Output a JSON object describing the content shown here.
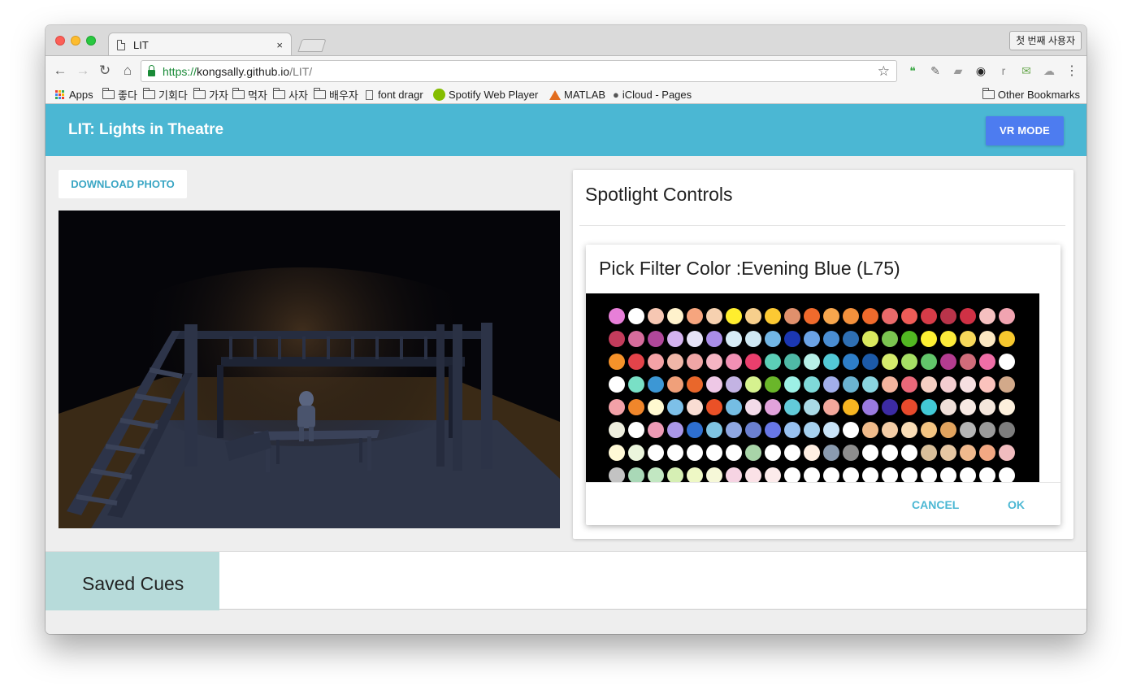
{
  "browser": {
    "tab_title": "LIT",
    "tab_close": "×",
    "profile_label": "첫 번째 사용자",
    "url_scheme": "https://",
    "url_host": "kongsally.github.io",
    "url_path": "/LIT/",
    "nav_back": "←",
    "nav_forward": "→",
    "nav_reload": "↻",
    "nav_home": "⌂",
    "star": "☆",
    "menu": "⋮",
    "extensions": [
      {
        "name": "hangouts-icon",
        "glyph": "❝",
        "color": "#3aa745"
      },
      {
        "name": "eyedropper-icon",
        "glyph": "✎",
        "color": "#666666"
      },
      {
        "name": "pin-icon",
        "glyph": "▰",
        "color": "#9a9a9a"
      },
      {
        "name": "panda-icon",
        "glyph": "◉",
        "color": "#222222"
      },
      {
        "name": "r-icon",
        "glyph": "r",
        "color": "#888888"
      },
      {
        "name": "inbox-icon",
        "glyph": "✉",
        "color": "#6aa84f"
      },
      {
        "name": "cloud-icon",
        "glyph": "☁",
        "color": "#9a9a9a"
      }
    ],
    "bookmarks": [
      {
        "label": "Apps",
        "icon": "apps"
      },
      {
        "label": "좋다",
        "icon": "folder"
      },
      {
        "label": "기회다",
        "icon": "folder"
      },
      {
        "label": "가자",
        "icon": "folder"
      },
      {
        "label": "먹자",
        "icon": "folder"
      },
      {
        "label": "사자",
        "icon": "folder"
      },
      {
        "label": "배우자",
        "icon": "folder"
      },
      {
        "label": "font dragr",
        "icon": "page"
      },
      {
        "label": "Spotify Web Player",
        "icon": "spotify"
      },
      {
        "label": "MATLAB",
        "icon": "matlab"
      },
      {
        "label": "iCloud - Pages",
        "icon": "apple"
      }
    ],
    "other_bookmarks": "Other Bookmarks"
  },
  "app": {
    "title": "LIT: Lights in Theatre",
    "vr_button": "VR MODE",
    "download_button": "DOWNLOAD PHOTO",
    "spotlight_title": "Spotlight Controls",
    "dialog": {
      "title": "Pick Filter Color :Evening Blue (L75)",
      "cancel": "CANCEL",
      "ok": "OK"
    },
    "saved_cues": "Saved Cues"
  },
  "swatch_colors": [
    [
      "#e77fd8",
      "#ffffff",
      "#f6c7b3",
      "#fff2cc",
      "#f6a57e",
      "#f6d1b0",
      "#ffee2e",
      "#f7cf8c",
      "#fcc933",
      "#e0906c",
      "#ef6a2c",
      "#f7a64d",
      "#f3903c",
      "#ef6a2c",
      "#ea6a6a",
      "#ef5c57",
      "#d63c48",
      "#b9344a",
      "#d03145",
      "#f5c0c0",
      "#f1a4b1"
    ],
    [
      "#c33c5c",
      "#d66c9c",
      "#b0479a",
      "#d4b3ef",
      "#e6e3f7",
      "#a98de8",
      "#d7ecf6",
      "#cfe8f3",
      "#72b6e5",
      "#1b37b2",
      "#6ba3e6",
      "#4a8ed3",
      "#2e6fb3",
      "#d9e95e",
      "#7bc550",
      "#52b822",
      "#fdf033",
      "#fdeb3a",
      "#f7d85a",
      "#fbe7c1",
      "#f7c82e"
    ],
    [
      "#f5922a",
      "#e3434a",
      "#f4a2a6",
      "#f0b7a8",
      "#f0a6a6",
      "#f5b5c3",
      "#f190b4",
      "#ea3f6d",
      "#5ccfb7",
      "#4fb9a6",
      "#b7f0e8",
      "#53c9d6",
      "#2e7ec8",
      "#1c5aa8",
      "#d5ec6c",
      "#a6df64",
      "#62c66a",
      "#b43c90",
      "#d06c7a",
      "#ee6ea6",
      "#ffffff"
    ],
    [
      "#ffffff",
      "#79e0c6",
      "#3c97d5",
      "#f0a07a",
      "#e9672b",
      "#eec8e6",
      "#c3b3e3",
      "#d6f28f",
      "#6ab62a",
      "#9df0e6",
      "#7fd9d9",
      "#a2aeea",
      "#6bb3d1",
      "#8ad5e0",
      "#f4b49e",
      "#ea6879",
      "#f6cfc3",
      "#f3cdd0",
      "#f6dfe1",
      "#fbc3bd",
      "#d2a98a"
    ],
    [
      "#f2a1a8",
      "#f0862b",
      "#fff9d0",
      "#7dc0e8",
      "#f9ddd3",
      "#ea5127",
      "#75bde3",
      "#f3dbe9",
      "#e2a2db",
      "#62cbd9",
      "#a9d9e6",
      "#f3a89c",
      "#f7b521",
      "#9a7ae0",
      "#3c2ba4",
      "#e84a2c",
      "#42c9d6",
      "#f0dfd8",
      "#f7e9e3",
      "#f4e6db",
      "#fdf0dc"
    ],
    [
      "#eeeede",
      "#ffffff",
      "#ee9ab5",
      "#aa97e8",
      "#2e6fd0",
      "#7fc4e2",
      "#8fa7e2",
      "#6b80d1",
      "#6877e6",
      "#98c1f0",
      "#a6d1ef",
      "#c8e3f7",
      "#ffffff",
      "#f0bb8b",
      "#f4cda6",
      "#faddb6",
      "#f3c482",
      "#e1a35e",
      "#b5b5b5",
      "#9a9a9a",
      "#7e7e7e"
    ],
    [
      "#fff9d6",
      "#ebf5dc",
      "#ffffff",
      "#ffffff",
      "#ffffff",
      "#ffffff",
      "#ffffff",
      "#a8d4a8",
      "#ffffff",
      "#ffffff",
      "#fff0e3",
      "#8a9bb0",
      "#8e8e8e",
      "#ffffff",
      "#ffffff",
      "#ffffff",
      "#d9bf9a",
      "#e6c7a2",
      "#f0b98d",
      "#f2a883",
      "#f1bcbf"
    ],
    [
      "#c3c3c3",
      "#a9d8b7",
      "#c2e7c2",
      "#d6efb4",
      "#eef8c5",
      "#f6f8d8",
      "#f6d4e3",
      "#fbe2e7",
      "#fcebeb",
      "#ffffff",
      "#ffffff",
      "#ffffff",
      "#ffffff",
      "#ffffff",
      "#ffffff",
      "#ffffff",
      "#ffffff",
      "#ffffff",
      "#ffffff",
      "#ffffff",
      "#ffffff"
    ]
  ]
}
